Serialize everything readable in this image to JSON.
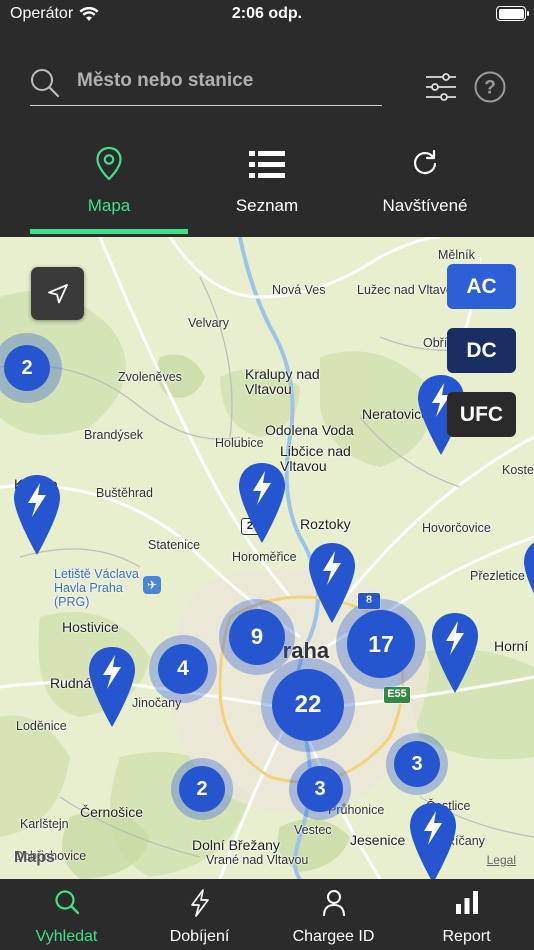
{
  "status": {
    "carrier": "Operátor",
    "time": "2:06 odp."
  },
  "search": {
    "placeholder": "Město nebo stanice"
  },
  "tabs": [
    {
      "label": "Mapa",
      "icon": "map-pin-icon",
      "active": true
    },
    {
      "label": "Seznam",
      "icon": "list-icon",
      "active": false
    },
    {
      "label": "Navštívené",
      "icon": "refresh-icon",
      "active": false
    }
  ],
  "filters": {
    "ac": "AC",
    "dc": "DC",
    "ufc": "UFC"
  },
  "colors": {
    "accent": "#3fe08a",
    "cluster": "#2656cf",
    "ac": "#2d5fd6",
    "dc": "#1a2e63",
    "ufc": "#2a2a2a",
    "header": "#2b2b2b"
  },
  "map": {
    "places": [
      "Mělník",
      "Nová Ves",
      "Lužec nad Vltavou",
      "Velvary",
      "Obříství",
      "Zvoleněves",
      "Kralupy nad Vltavou",
      "Neratovice",
      "Brandýsek",
      "Odolena Voda",
      "Holubice",
      "Libčice nad Vltavou",
      "Kostelec",
      "Kladno",
      "Buštěhrad",
      "Roztoky",
      "Hovorčovice",
      "Statenice",
      "Horoměřice",
      "Letiště Václava Havla Praha (PRG)",
      "Přezletice",
      "Hostivice",
      "Praha",
      "Horní",
      "Rudná",
      "Jinočany",
      "Loděnice",
      "Černošice",
      "Průhonice",
      "Čestlice",
      "Karlštejn",
      "Vestec",
      "Jesenice",
      "Dobřichovice",
      "Dolní Břežany",
      "Vrané nad Vltavou",
      "Říčany"
    ],
    "roads": [
      "24",
      "E55",
      "8"
    ],
    "clusters": [
      "2",
      "9",
      "17",
      "4",
      "22",
      "2",
      "3",
      "3"
    ],
    "legal": "Legal",
    "logo": "Maps"
  },
  "bottom_tabs": [
    {
      "label": "Vyhledat",
      "icon": "search-icon",
      "active": true
    },
    {
      "label": "Dobíjení",
      "icon": "lightning-icon",
      "active": false
    },
    {
      "label": "Chargee ID",
      "icon": "user-icon",
      "active": false
    },
    {
      "label": "Report",
      "icon": "bar-chart-icon",
      "active": false
    }
  ]
}
